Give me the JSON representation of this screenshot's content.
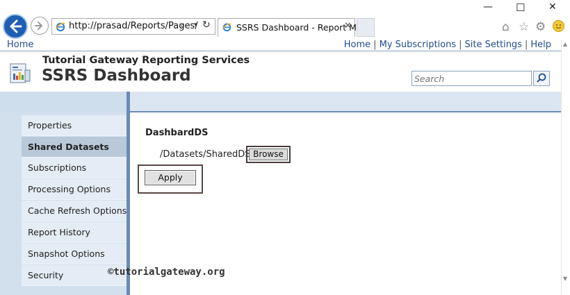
{
  "browser": {
    "url": "http://prasad/Reports/Pages/",
    "tab_title": "SSRS Dashboard - Report M...",
    "tab_close": "✕",
    "minimize": "—",
    "maximize": "☐",
    "close": "✕",
    "toolbar_icons": [
      "home-icon",
      "star-icon",
      "gear-icon",
      "smiley-icon"
    ],
    "accent": "#1e5fb4"
  },
  "top_nav": {
    "home_left": "Home",
    "links": [
      "Home",
      "My Subscriptions",
      "Site Settings",
      "Help"
    ]
  },
  "header": {
    "site_name": "Tutorial Gateway Reporting Services",
    "page_title": "SSRS Dashboard",
    "search_placeholder": "Search"
  },
  "sidebar": {
    "items": [
      {
        "label": "Properties",
        "active": false
      },
      {
        "label": "Shared Datasets",
        "active": true
      },
      {
        "label": "Subscriptions",
        "active": false
      },
      {
        "label": "Processing Options",
        "active": false
      },
      {
        "label": "Cache Refresh Options",
        "active": false
      },
      {
        "label": "Report History",
        "active": false
      },
      {
        "label": "Snapshot Options",
        "active": false
      },
      {
        "label": "Security",
        "active": false
      }
    ]
  },
  "content": {
    "dataset_name": "DashbardDS",
    "dataset_path": "/Datasets/SharedDS",
    "browse_label": "Browse",
    "apply_label": "Apply"
  },
  "watermark": "©tutorialgateway.org",
  "colors": {
    "nav_bg": "#e4ecf5",
    "nav_active": "#b9c9da",
    "divider": "#6a8cb4",
    "link": "#1f4c8f"
  }
}
